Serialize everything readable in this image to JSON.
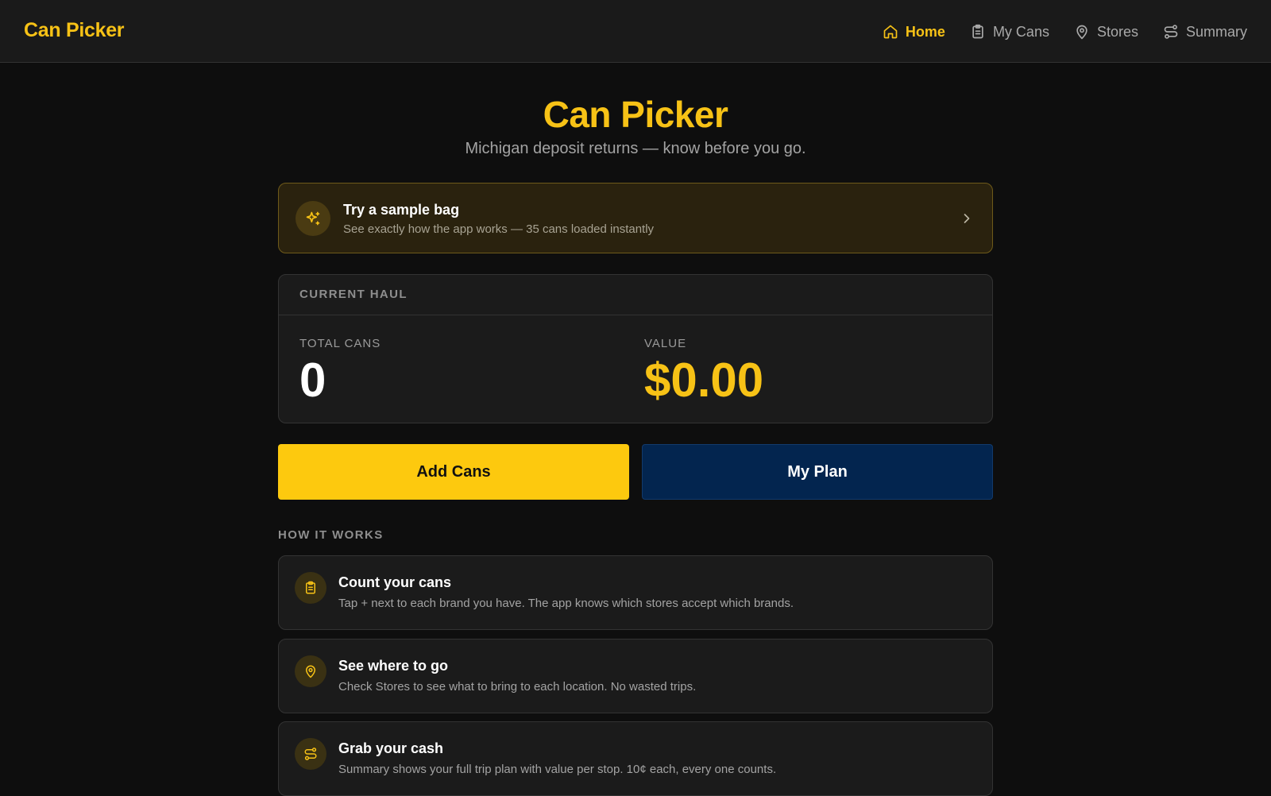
{
  "header": {
    "brand": "Can Picker",
    "nav": [
      {
        "label": "Home",
        "icon": "home-icon",
        "active": true
      },
      {
        "label": "My Cans",
        "icon": "clipboard-icon",
        "active": false
      },
      {
        "label": "Stores",
        "icon": "map-pin-icon",
        "active": false
      },
      {
        "label": "Summary",
        "icon": "route-icon",
        "active": false
      }
    ]
  },
  "hero": {
    "title": "Can Picker",
    "subtitle": "Michigan deposit returns — know before you go."
  },
  "sample": {
    "title": "Try a sample bag",
    "description": "See exactly how the app works — 35 cans loaded instantly",
    "icon": "sparkles-icon"
  },
  "haul": {
    "header": "CURRENT HAUL",
    "total_label": "TOTAL CANS",
    "total_value": "0",
    "value_label": "VALUE",
    "value_value": "$0.00"
  },
  "actions": {
    "add_label": "Add Cans",
    "plan_label": "My Plan"
  },
  "how": {
    "label": "HOW IT WORKS",
    "steps": [
      {
        "title": "Count your cans",
        "description": "Tap + next to each brand you have. The app knows which stores accept which brands.",
        "icon": "clipboard-icon"
      },
      {
        "title": "See where to go",
        "description": "Check Stores to see what to bring to each location. No wasted trips.",
        "icon": "map-pin-icon"
      },
      {
        "title": "Grab your cash",
        "description": "Summary shows your full trip plan with value per stop. 10¢ each, every one counts.",
        "icon": "route-icon"
      }
    ]
  },
  "colors": {
    "accent": "#f7c216",
    "background": "#0e0e0e",
    "card": "#1b1b1b",
    "plan_button": "#03254f"
  }
}
